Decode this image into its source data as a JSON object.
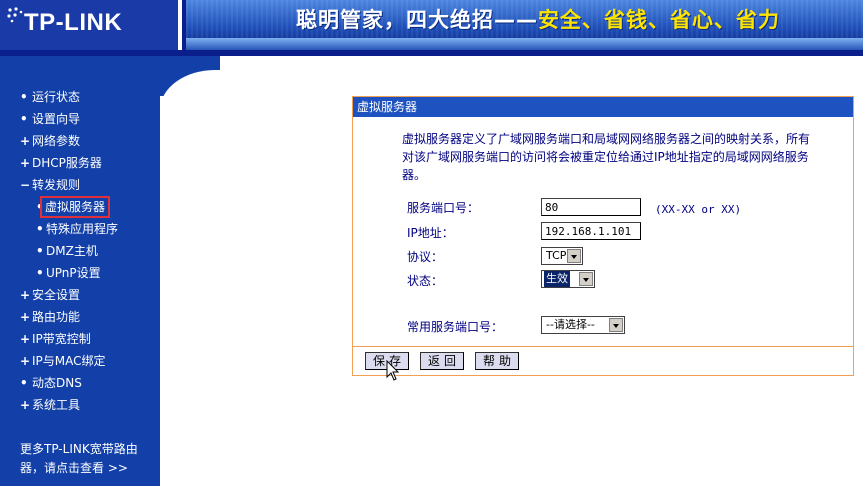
{
  "header": {
    "logo_text": "TP-LINK",
    "slogan_part1": "聪明管家，四大绝招——",
    "slogan_part2": "安全、省钱、省心、省力"
  },
  "sidebar": {
    "items": [
      {
        "bullet": "•",
        "label": "运行状态"
      },
      {
        "bullet": "•",
        "label": "设置向导"
      },
      {
        "bullet": "+",
        "label": "网络参数"
      },
      {
        "bullet": "+",
        "label": "DHCP服务器"
      },
      {
        "bullet": "−",
        "label": "转发规则"
      },
      {
        "bullet": "•",
        "label": "虚拟服务器"
      },
      {
        "bullet": "•",
        "label": "特殊应用程序"
      },
      {
        "bullet": "•",
        "label": "DMZ主机"
      },
      {
        "bullet": "•",
        "label": "UPnP设置"
      },
      {
        "bullet": "+",
        "label": "安全设置"
      },
      {
        "bullet": "+",
        "label": "路由功能"
      },
      {
        "bullet": "+",
        "label": "IP带宽控制"
      },
      {
        "bullet": "+",
        "label": "IP与MAC绑定"
      },
      {
        "bullet": "•",
        "label": "动态DNS"
      },
      {
        "bullet": "+",
        "label": "系统工具"
      }
    ],
    "footer_line1": "更多TP-LINK宽带路由",
    "footer_line2": "器，请点击查看 >>"
  },
  "panel": {
    "title": "虚拟服务器",
    "description": "虚拟服务器定义了广域网服务端口和局域网网络服务器之间的映射关系，所有对该广域网服务端口的访问将会被重定位给通过IP地址指定的局域网网络服务器。",
    "fields": {
      "port_label": "服务端口号：",
      "port_value": "80",
      "port_hint": "(XX-XX or XX)",
      "ip_label": "IP地址：",
      "ip_value": "192.168.1.101",
      "protocol_label": "协议：",
      "protocol_value": "TCP",
      "status_label": "状态：",
      "status_value": "生效",
      "common_port_label": "常用服务端口号：",
      "common_port_value": "--请选择--"
    },
    "buttons": {
      "save": "保存",
      "back": "返回",
      "help": "帮助"
    }
  },
  "colors": {
    "header_bg": "#0a1f8c",
    "sidebar_bg": "#1240a8",
    "panel_title_bg": "#1d52c0",
    "panel_border": "#f0a050",
    "selected_outline": "#e0303a",
    "slogan_accent": "#ffe400"
  }
}
